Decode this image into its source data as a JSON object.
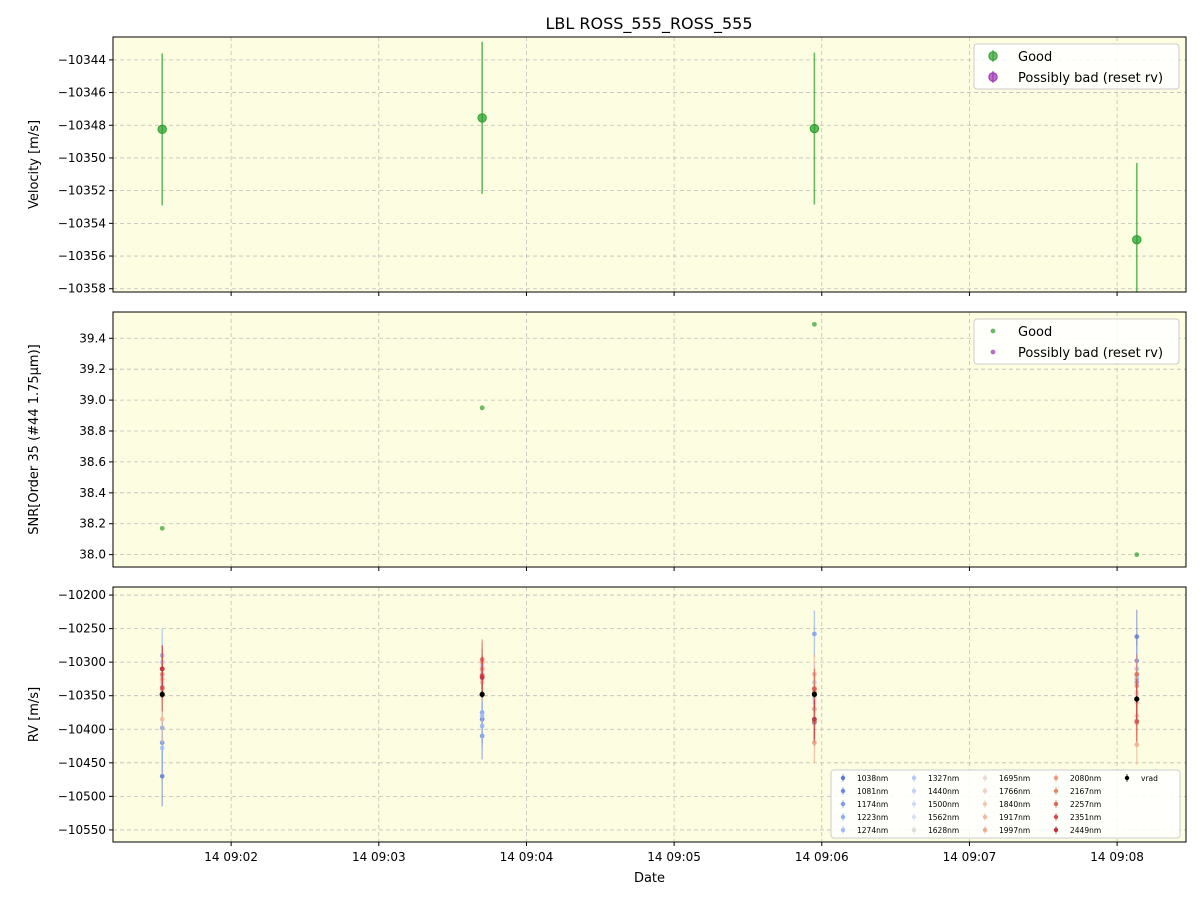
{
  "page": {
    "title": "LBL ROSS_555_ROSS_555"
  },
  "chart_data": [
    {
      "type": "scatter",
      "ylabel": "Velocity [m/s]",
      "xlabel": "",
      "background": "#fdfde2",
      "grid": true,
      "legend_placement": "top-right",
      "x_ticks": [
        "14 09:02",
        "14 09:03",
        "14 09:04",
        "14 09:05",
        "14 09:06",
        "14 09:07",
        "14 09:08"
      ],
      "xlim": [
        "09:01:12",
        "09:08:28"
      ],
      "ylim": [
        -10358.2,
        -10342.6
      ],
      "y_ticks": [
        -10344,
        -10346,
        -10348,
        -10350,
        -10352,
        -10354,
        -10356,
        -10358
      ],
      "series": [
        {
          "name": "Good",
          "color": "#2ca02c",
          "points": [
            {
              "x": "09:01:32",
              "y": -10348.25,
              "err": 4.65
            },
            {
              "x": "09:03:42",
              "y": -10347.55,
              "err": 4.65
            },
            {
              "x": "09:05:57",
              "y": -10348.2,
              "err": 4.65
            },
            {
              "x": "09:08:08",
              "y": -10355.0,
              "err": 4.7
            }
          ]
        },
        {
          "name": "Possibly bad (reset rv)",
          "color": "#9b30b0",
          "points": []
        }
      ]
    },
    {
      "type": "scatter",
      "ylabel": "SNR[Order 35 (#44 1.75μm)]",
      "xlabel": "",
      "background": "#fdfde2",
      "grid": true,
      "legend_placement": "top-right",
      "x_ticks": [
        "14 09:02",
        "14 09:03",
        "14 09:04",
        "14 09:05",
        "14 09:06",
        "14 09:07",
        "14 09:08"
      ],
      "ylim": [
        37.92,
        39.57
      ],
      "y_ticks": [
        38.0,
        38.2,
        38.4,
        38.6,
        38.8,
        39.0,
        39.2,
        39.4
      ],
      "y_tick_labels": [
        "38.0",
        "38.2",
        "38.4",
        "38.6",
        "38.8",
        "39.0",
        "39.2",
        "39.4"
      ],
      "series": [
        {
          "name": "Good",
          "color": "#2ca02c",
          "points": [
            {
              "x": "09:01:32",
              "y": 38.17
            },
            {
              "x": "09:03:42",
              "y": 38.95
            },
            {
              "x": "09:05:57",
              "y": 39.49
            },
            {
              "x": "09:08:08",
              "y": 38.0
            }
          ]
        },
        {
          "name": "Possibly bad (reset rv)",
          "color": "#9b30b0",
          "points": []
        }
      ]
    },
    {
      "type": "scatter",
      "ylabel": "RV [m/s]",
      "xlabel": "Date",
      "background": "#fdfde2",
      "grid": true,
      "legend_placement": "bottom-right",
      "x_ticks": [
        "14 09:02",
        "14 09:03",
        "14 09:04",
        "14 09:05",
        "14 09:06",
        "14 09:07",
        "14 09:08"
      ],
      "ylim": [
        -10568,
        -10188
      ],
      "y_ticks": [
        -10200,
        -10250,
        -10300,
        -10350,
        -10400,
        -10450,
        -10500,
        -10550
      ],
      "times": [
        "09:01:32",
        "09:03:42",
        "09:05:57",
        "09:08:08"
      ],
      "series": [
        {
          "name": "1038nm",
          "color": "#5a78d0",
          "values": [
            -10470,
            -10385,
            -10390,
            -10262
          ],
          "errs": [
            45,
            35,
            35,
            40
          ]
        },
        {
          "name": "1081nm",
          "color": "#6b8ae0",
          "values": [
            -10420,
            -10410,
            -10385,
            -10298
          ],
          "errs": [
            45,
            35,
            35,
            35
          ]
        },
        {
          "name": "1174nm",
          "color": "#7c9cec",
          "values": [
            -10398,
            -10375,
            -10258,
            -10330
          ],
          "errs": [
            45,
            35,
            35,
            35
          ]
        },
        {
          "name": "1223nm",
          "color": "#8fadf3",
          "values": [
            -10290,
            -10395,
            -10370,
            -10325
          ],
          "errs": [
            40,
            35,
            35,
            35
          ]
        },
        {
          "name": "1274nm",
          "color": "#a2bcf7",
          "values": [
            -10428,
            -10380,
            -10370,
            -10310
          ],
          "errs": [
            40,
            35,
            35,
            35
          ]
        },
        {
          "name": "1327nm",
          "color": "#b4c8f9",
          "values": [
            -10300,
            -10310,
            -10330,
            -10320
          ],
          "errs": [
            40,
            30,
            30,
            30
          ]
        },
        {
          "name": "1440nm",
          "color": "#c3d2f9",
          "values": [
            -10320,
            -10305,
            -10345,
            -10335
          ],
          "errs": [
            35,
            30,
            30,
            30
          ]
        },
        {
          "name": "1500nm",
          "color": "#cfdaf6",
          "values": [
            -10330,
            -10315,
            -10355,
            -10345
          ],
          "errs": [
            35,
            30,
            30,
            30
          ]
        },
        {
          "name": "1562nm",
          "color": "#d8e0f2",
          "values": [
            -10340,
            -10325,
            -10360,
            -10350
          ],
          "errs": [
            35,
            30,
            30,
            30
          ]
        },
        {
          "name": "1628nm",
          "color": "#dcdcdc",
          "values": [
            -10335,
            -10318,
            -10352,
            -10348
          ],
          "errs": [
            35,
            30,
            30,
            30
          ]
        },
        {
          "name": "1695nm",
          "color": "#e7dcd3",
          "values": [
            -10345,
            -10320,
            -10345,
            -10352
          ],
          "errs": [
            35,
            30,
            30,
            30
          ]
        },
        {
          "name": "1766nm",
          "color": "#efd2c2",
          "values": [
            -10330,
            -10312,
            -10340,
            -10345
          ],
          "errs": [
            35,
            30,
            30,
            30
          ]
        },
        {
          "name": "1840nm",
          "color": "#f3c6b0",
          "values": [
            -10350,
            -10322,
            -10338,
            -10360
          ],
          "errs": [
            35,
            30,
            30,
            30
          ]
        },
        {
          "name": "1917nm",
          "color": "#f4b89d",
          "values": [
            -10385,
            -10330,
            -10370,
            -10380
          ],
          "errs": [
            35,
            30,
            30,
            30
          ]
        },
        {
          "name": "1997nm",
          "color": "#f2a98a",
          "values": [
            -10325,
            -10300,
            -10318,
            -10423
          ],
          "errs": [
            35,
            30,
            30,
            30
          ]
        },
        {
          "name": "2080nm",
          "color": "#ee9a78",
          "values": [
            -10340,
            -10310,
            -10420,
            -10335
          ],
          "errs": [
            35,
            30,
            30,
            30
          ]
        },
        {
          "name": "2167nm",
          "color": "#e88867",
          "values": [
            -10318,
            -10322,
            -10345,
            -10390
          ],
          "errs": [
            35,
            30,
            30,
            30
          ]
        },
        {
          "name": "2257nm",
          "color": "#e06858",
          "values": [
            -10310,
            -10296,
            -10388,
            -10318
          ],
          "errs": [
            35,
            30,
            30,
            30
          ]
        },
        {
          "name": "2351nm",
          "color": "#d64d4d",
          "values": [
            -10338,
            -10320,
            -10340,
            -10388
          ],
          "errs": [
            35,
            30,
            30,
            30
          ]
        },
        {
          "name": "2449nm",
          "color": "#c22c3e",
          "values": [
            -10310,
            -10323,
            -10385,
            -10355
          ],
          "errs": [
            35,
            30,
            30,
            30
          ]
        },
        {
          "name": "vrad",
          "color": "#000000",
          "values": [
            -10348,
            -10348,
            -10348,
            -10355
          ],
          "errs": [
            5,
            5,
            5,
            5
          ]
        }
      ]
    }
  ]
}
